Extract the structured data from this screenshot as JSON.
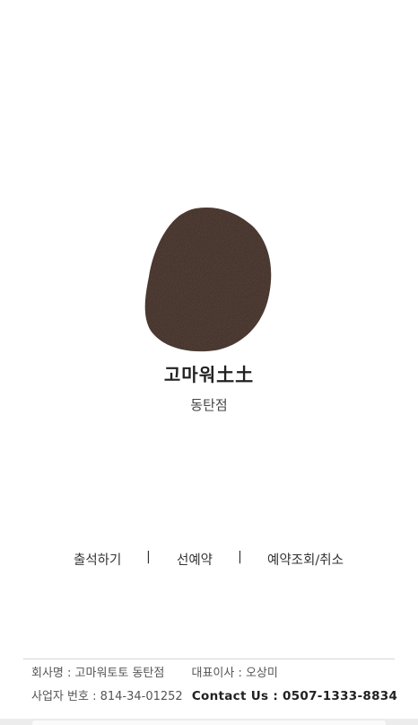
{
  "brand": {
    "name": "고마워土土",
    "branch": "동탄점",
    "logo_color": "#3b2a23"
  },
  "menu": {
    "items": [
      {
        "label": "출석하기"
      },
      {
        "label": "선예약"
      },
      {
        "label": "예약조회/취소"
      }
    ],
    "separator": "|"
  },
  "footer": {
    "company_label": "회사명 : 고마워토토 동탄점",
    "ceo_label": "대표이사 : 오상미",
    "biz_number": "사업자 번호 : 814-34-01252",
    "contact": "Contact Us : 0507-1333-8834"
  }
}
